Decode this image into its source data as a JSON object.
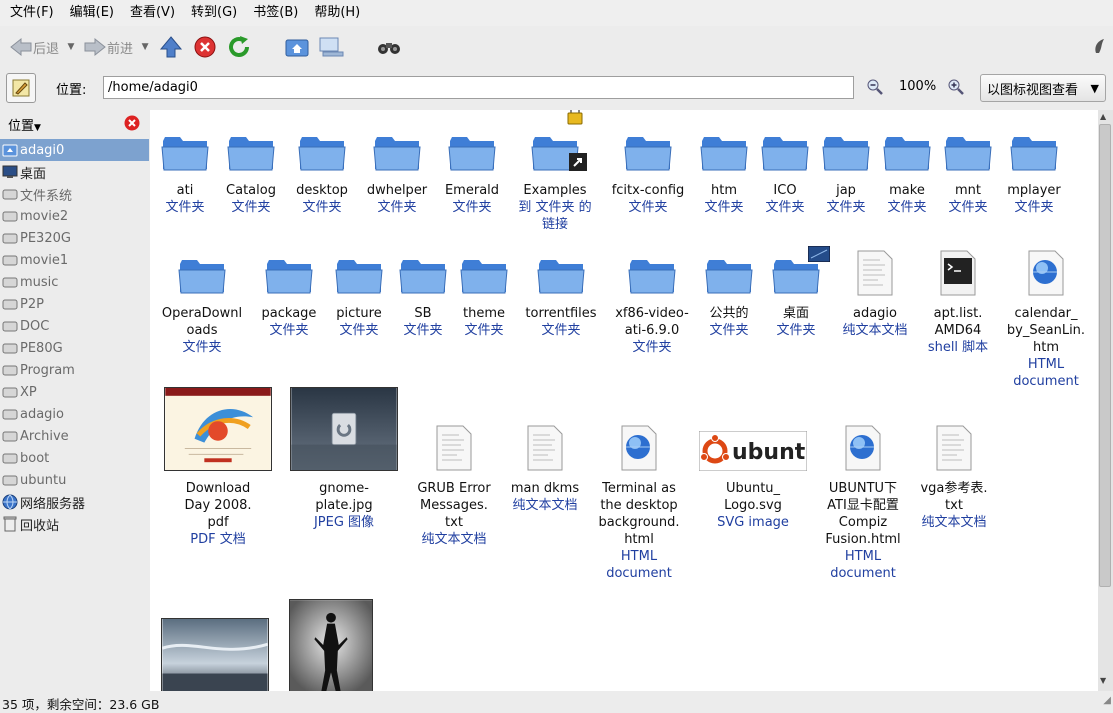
{
  "menu": [
    "文件(F)",
    "编辑(E)",
    "查看(V)",
    "转到(G)",
    "书签(B)",
    "帮助(H)"
  ],
  "toolbar": {
    "back_label": "后退",
    "forward_label": "前进"
  },
  "location": {
    "label": "位置:",
    "path": "/home/adagi0",
    "zoom": "100%",
    "view_mode": "以图标视图查看"
  },
  "sidebar": {
    "title": "位置",
    "items": [
      {
        "label": "adagi0",
        "icon": "home-icon"
      },
      {
        "label": "桌面",
        "icon": "desktop-icon"
      },
      {
        "label": "文件系统",
        "icon": "drive-icon"
      },
      {
        "label": "movie2",
        "icon": "drive-icon"
      },
      {
        "label": "PE320G",
        "icon": "drive-icon"
      },
      {
        "label": "movie1",
        "icon": "drive-icon"
      },
      {
        "label": "music",
        "icon": "drive-icon"
      },
      {
        "label": "P2P",
        "icon": "drive-icon"
      },
      {
        "label": "DOC",
        "icon": "drive-icon"
      },
      {
        "label": "PE80G",
        "icon": "drive-icon"
      },
      {
        "label": "Program",
        "icon": "drive-icon"
      },
      {
        "label": "XP",
        "icon": "drive-icon"
      },
      {
        "label": "adagio",
        "icon": "drive-icon"
      },
      {
        "label": "Archive",
        "icon": "drive-icon"
      },
      {
        "label": "boot",
        "icon": "drive-icon"
      },
      {
        "label": "ubuntu",
        "icon": "drive-icon"
      },
      {
        "label": "网络服务器",
        "icon": "network-icon"
      },
      {
        "label": "回收站",
        "icon": "trash-icon"
      }
    ]
  },
  "files": [
    {
      "name": "ati",
      "type": "文件夹",
      "icon": "folder-icon"
    },
    {
      "name": "Catalog",
      "type": "文件夹",
      "icon": "folder-icon"
    },
    {
      "name": "desktop",
      "type": "文件夹",
      "icon": "folder-icon"
    },
    {
      "name": "dwhelper",
      "type": "文件夹",
      "icon": "folder-icon"
    },
    {
      "name": "Emerald",
      "type": "文件夹",
      "icon": "folder-icon"
    },
    {
      "name": "Examples",
      "type": "到 文件夹 的链接",
      "icon": "folder-link-icon"
    },
    {
      "name": "fcitx-config",
      "type": "文件夹",
      "icon": "folder-icon"
    },
    {
      "name": "htm",
      "type": "文件夹",
      "icon": "folder-icon"
    },
    {
      "name": "ICO",
      "type": "文件夹",
      "icon": "folder-icon"
    },
    {
      "name": "jap",
      "type": "文件夹",
      "icon": "folder-icon"
    },
    {
      "name": "make",
      "type": "文件夹",
      "icon": "folder-icon"
    },
    {
      "name": "mnt",
      "type": "文件夹",
      "icon": "folder-icon"
    },
    {
      "name": "mplayer",
      "type": "文件夹",
      "icon": "folder-icon"
    },
    {
      "name": "OperaDownloads",
      "type": "文件夹",
      "icon": "folder-icon"
    },
    {
      "name": "package",
      "type": "文件夹",
      "icon": "folder-icon"
    },
    {
      "name": "picture",
      "type": "文件夹",
      "icon": "folder-icon"
    },
    {
      "name": "SB",
      "type": "文件夹",
      "icon": "folder-icon"
    },
    {
      "name": "theme",
      "type": "文件夹",
      "icon": "folder-icon"
    },
    {
      "name": "torrentfiles",
      "type": "文件夹",
      "icon": "folder-icon"
    },
    {
      "name": "xf86-video-ati-6.9.0",
      "type": "文件夹",
      "icon": "folder-icon"
    },
    {
      "name": "公共的",
      "type": "文件夹",
      "icon": "folder-icon"
    },
    {
      "name": "桌面",
      "type": "文件夹",
      "icon": "desktop-folder-icon"
    },
    {
      "name": "adagio",
      "type": "纯文本文档",
      "icon": "text-file-icon"
    },
    {
      "name": "apt.list.AMD64",
      "type": "shell 脚本",
      "icon": "terminal-icon"
    },
    {
      "name": "calendar_by_SeanLin.htm",
      "type": "HTML document",
      "icon": "html-globe-icon"
    },
    {
      "name": "Download Day 2008.pdf",
      "type": "PDF 文档",
      "icon": "pdf-thumb-icon"
    },
    {
      "name": "gnome-plate.jpg",
      "type": "JPEG 图像",
      "icon": "image-thumb-icon"
    },
    {
      "name": "GRUB Error Messages.txt",
      "type": "纯文本文档",
      "icon": "text-file-icon"
    },
    {
      "name": "man dkms",
      "type": "纯文本文档",
      "icon": "text-file-icon"
    },
    {
      "name": "Terminal as the desktop background.html",
      "type": "HTML document",
      "icon": "html-globe-icon"
    },
    {
      "name": "Ubuntu_Logo.svg",
      "type": "SVG image",
      "icon": "ubuntu-logo-icon",
      "logo_text": "ubuntu"
    },
    {
      "name": "UBUNTU下ATI显卡配置Compiz Fusion.html",
      "type": "HTML document",
      "icon": "html-globe-icon"
    },
    {
      "name": "vga参考表.txt",
      "type": "纯文本文档",
      "icon": "text-file-icon"
    },
    {
      "name": "",
      "type": "",
      "icon": "landscape-thumb-icon"
    },
    {
      "name": "",
      "type": "",
      "icon": "figure-thumb-icon"
    }
  ],
  "labels": {
    "ati": "ati",
    "Catalog": "Catalog",
    "desktop": "desktop",
    "dwhelper": "dwhelper",
    "Emerald": "Emerald",
    "Examples": "Examples",
    "fcitx": "fcitx-config",
    "htm": "htm",
    "ICO": "ICO",
    "jap": "jap",
    "make": "make",
    "mnt": "mnt",
    "mplayer": "mplayer",
    "opera1": "OperaDownl",
    "opera2": "oads",
    "package": "package",
    "picture": "picture",
    "SB": "SB",
    "theme": "theme",
    "torrent": "torrentfiles",
    "xf1": "xf86-video-",
    "xf2": "ati-6.9.0",
    "public": "公共的",
    "desk": "桌面",
    "adagio": "adagio",
    "apt1": "apt.list.",
    "apt2": "AMD64",
    "cal1": "calendar_",
    "cal2": "by_SeanLin.",
    "cal3": "htm",
    "dl1": "Download",
    "dl2": "Day 2008.",
    "dl3": "pdf",
    "gp1": "gnome-",
    "gp2": "plate.jpg",
    "grub1": "GRUB Error",
    "grub2": "Messages.",
    "grub3": "txt",
    "man": "man dkms",
    "term1": "Terminal as",
    "term2": "the desktop",
    "term3": "background.",
    "term4": "html",
    "ub1": "Ubuntu_",
    "ub2": "Logo.svg",
    "ati1": "UBUNTU下",
    "ati2": "ATI显卡配置",
    "ati3": "Compiz",
    "ati4": "Fusion.html",
    "vga1": "vga参考表.",
    "vga2": "txt",
    "folder_type": "文件夹",
    "link1": "到 文件夹 的",
    "link2": "链接",
    "text_type": "纯文本文档",
    "shell_type": "shell 脚本",
    "html1": "HTML",
    "html2": "document",
    "pdf_type": "PDF 文档",
    "jpeg_type": "JPEG 图像",
    "svg_type": "SVG image"
  },
  "status": {
    "text": "35 项，剩余空间：23.6 GB"
  },
  "colors": {
    "selection": "#7da2cf",
    "file_type_text": "#203fa0",
    "folder_blue": "#5b93dc"
  }
}
